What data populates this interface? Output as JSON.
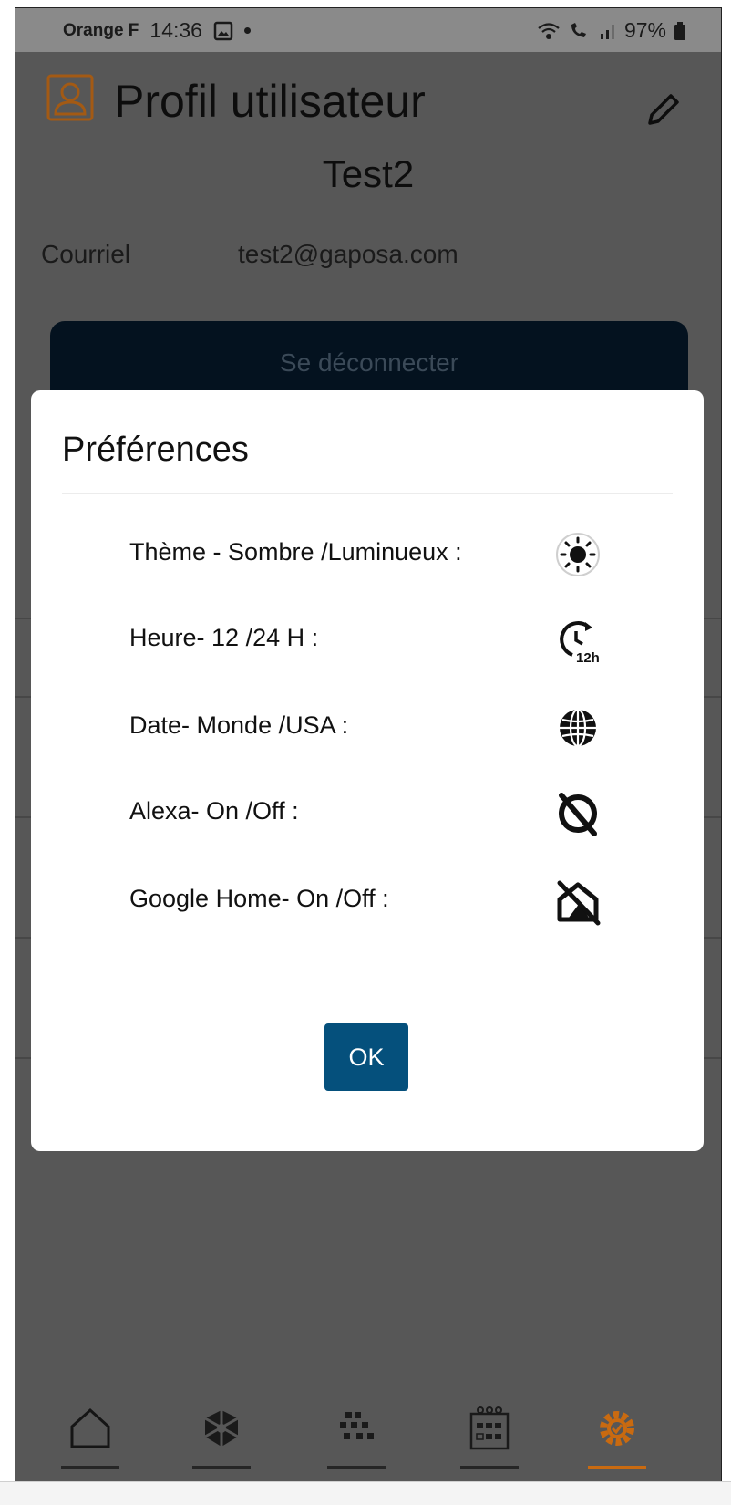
{
  "status_bar": {
    "carrier": "Orange F",
    "time": "14:36",
    "battery": "97%"
  },
  "header": {
    "title": "Profil utilisateur",
    "username": "Test2"
  },
  "profile": {
    "email_label": "Courriel",
    "email_value": "test2@gaposa.com",
    "logout_label": "Se déconnecter"
  },
  "dialog": {
    "title": "Préférences",
    "rows": [
      {
        "label": "Thème - Sombre /Luminueux :",
        "icon": "sun-icon"
      },
      {
        "label": "Heure- 12 /24 H :",
        "icon": "clock-12h-icon"
      },
      {
        "label": "Date- Monde /USA :",
        "icon": "globe-icon"
      },
      {
        "label": "Alexa- On /Off :",
        "icon": "alexa-off-icon"
      },
      {
        "label": "Google Home- On /Off :",
        "icon": "google-home-off-icon"
      }
    ],
    "ok_label": "OK"
  },
  "bottom_nav": [
    {
      "name": "home",
      "icon": "home-icon",
      "active": false
    },
    {
      "name": "devices",
      "icon": "cube-icon",
      "active": false
    },
    {
      "name": "scenes",
      "icon": "grid-dots-icon",
      "active": false
    },
    {
      "name": "schedule",
      "icon": "calendar-icon",
      "active": false
    },
    {
      "name": "settings",
      "icon": "settings-gear-icon",
      "active": true
    }
  ],
  "colors": {
    "overlay_background": "#575757",
    "accent_orange": "#c96a10",
    "ok_button": "#05507c",
    "logout_button": "#04121f"
  }
}
